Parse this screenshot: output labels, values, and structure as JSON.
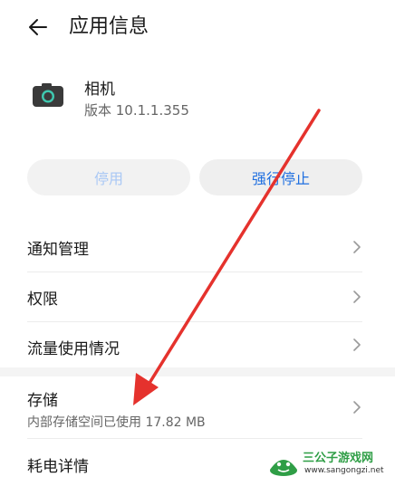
{
  "header": {
    "title": "应用信息",
    "back_icon": "arrow-left-icon"
  },
  "app": {
    "name": "相机",
    "version": "版本 10.1.1.355",
    "icon": "camera-icon"
  },
  "actions": {
    "disable_label": "停用",
    "force_stop_label": "强行停止"
  },
  "items": [
    {
      "label": "通知管理"
    },
    {
      "label": "权限"
    },
    {
      "label": "流量使用情况"
    },
    {
      "label": "存储",
      "sub": "内部存储空间已使用 17.82 MB"
    },
    {
      "label": "耗电详情"
    }
  ],
  "watermark": {
    "name": "三公子游戏网",
    "url": "www.sangongzi.net"
  },
  "colors": {
    "accent": "#1f6fe0",
    "disabled_text": "#a9c8f5",
    "annotation_arrow": "#e5322d",
    "camera_lens": "#3fc9b0"
  }
}
